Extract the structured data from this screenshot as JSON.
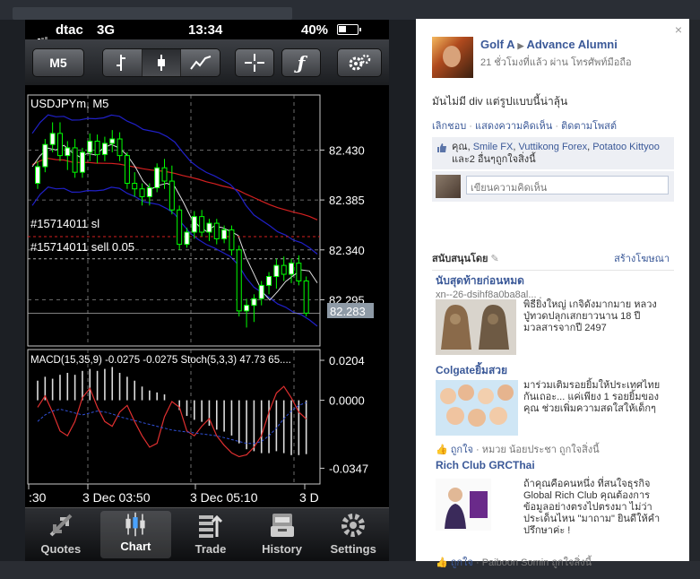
{
  "status_bar": {
    "carrier": "dtac",
    "network": "3G",
    "time": "13:34",
    "battery": "40%"
  },
  "toolbar": {
    "timeframe_label": "M5",
    "icons": [
      "bar-chart-icon",
      "candlestick-icon",
      "line-chart-icon",
      "crosshair-icon",
      "function-icon",
      "settings-gears-icon"
    ]
  },
  "chart_data": [
    {
      "type": "candlestick",
      "title": "USDJPYm, M5",
      "ylim": [
        82.255,
        82.478
      ],
      "y_ticks": [
        "82.430",
        "82.385",
        "82.340",
        "82.295"
      ],
      "current_price": "82.283",
      "annotations": [
        "#15714011 sl",
        "#15714011 sell 0.05"
      ],
      "candles": [
        {
          "o": 82.4,
          "h": 82.42,
          "l": 82.395,
          "c": 82.415
        },
        {
          "o": 82.415,
          "h": 82.44,
          "l": 82.41,
          "c": 82.435
        },
        {
          "o": 82.435,
          "h": 82.455,
          "l": 82.428,
          "c": 82.445
        },
        {
          "o": 82.445,
          "h": 82.455,
          "l": 82.42,
          "c": 82.425
        },
        {
          "o": 82.425,
          "h": 82.438,
          "l": 82.412,
          "c": 82.432
        },
        {
          "o": 82.432,
          "h": 82.44,
          "l": 82.405,
          "c": 82.41
        },
        {
          "o": 82.41,
          "h": 82.432,
          "l": 82.405,
          "c": 82.428
        },
        {
          "o": 82.428,
          "h": 82.445,
          "l": 82.42,
          "c": 82.438
        },
        {
          "o": 82.438,
          "h": 82.444,
          "l": 82.418,
          "c": 82.426
        },
        {
          "o": 82.426,
          "h": 82.442,
          "l": 82.42,
          "c": 82.436
        },
        {
          "o": 82.436,
          "h": 82.448,
          "l": 82.428,
          "c": 82.44
        },
        {
          "o": 82.44,
          "h": 82.446,
          "l": 82.42,
          "c": 82.425
        },
        {
          "o": 82.425,
          "h": 82.428,
          "l": 82.395,
          "c": 82.4
        },
        {
          "o": 82.4,
          "h": 82.41,
          "l": 82.388,
          "c": 82.395
        },
        {
          "o": 82.395,
          "h": 82.4,
          "l": 82.38,
          "c": 82.388
        },
        {
          "o": 82.388,
          "h": 82.4,
          "l": 82.38,
          "c": 82.396
        },
        {
          "o": 82.396,
          "h": 82.418,
          "l": 82.392,
          "c": 82.414
        },
        {
          "o": 82.414,
          "h": 82.422,
          "l": 82.395,
          "c": 82.402
        },
        {
          "o": 82.402,
          "h": 82.416,
          "l": 82.372,
          "c": 82.376
        },
        {
          "o": 82.376,
          "h": 82.38,
          "l": 82.34,
          "c": 82.345
        },
        {
          "o": 82.345,
          "h": 82.36,
          "l": 82.342,
          "c": 82.356
        },
        {
          "o": 82.356,
          "h": 82.375,
          "l": 82.35,
          "c": 82.37
        },
        {
          "o": 82.37,
          "h": 82.376,
          "l": 82.352,
          "c": 82.356
        },
        {
          "o": 82.356,
          "h": 82.368,
          "l": 82.348,
          "c": 82.364
        },
        {
          "o": 82.364,
          "h": 82.368,
          "l": 82.345,
          "c": 82.35
        },
        {
          "o": 82.35,
          "h": 82.362,
          "l": 82.346,
          "c": 82.358
        },
        {
          "o": 82.358,
          "h": 82.362,
          "l": 82.335,
          "c": 82.34
        },
        {
          "o": 82.34,
          "h": 82.344,
          "l": 82.28,
          "c": 82.285
        },
        {
          "o": 82.285,
          "h": 82.296,
          "l": 82.27,
          "c": 82.29
        },
        {
          "o": 82.29,
          "h": 82.3,
          "l": 82.275,
          "c": 82.296
        },
        {
          "o": 82.296,
          "h": 82.312,
          "l": 82.29,
          "c": 82.308
        },
        {
          "o": 82.308,
          "h": 82.32,
          "l": 82.3,
          "c": 82.316
        },
        {
          "o": 82.316,
          "h": 82.332,
          "l": 82.305,
          "c": 82.326
        },
        {
          "o": 82.326,
          "h": 82.334,
          "l": 82.312,
          "c": 82.318
        },
        {
          "o": 82.318,
          "h": 82.332,
          "l": 82.31,
          "c": 82.328
        },
        {
          "o": 82.328,
          "h": 82.335,
          "l": 82.308,
          "c": 82.312
        },
        {
          "o": 82.312,
          "h": 82.316,
          "l": 82.28,
          "c": 82.283
        }
      ],
      "sl_price": 82.352,
      "entry_price": 82.332
    },
    {
      "type": "line",
      "title": "MACD(15,35,9) -0.0275 -0.0275 Stoch(5,3,3) 47.73 65....",
      "y_ticks": [
        "0.0204",
        "0.0000",
        "-0.0347"
      ],
      "ylim": [
        -0.04,
        0.0204
      ],
      "x_ticks": [
        ":30",
        "3 Dec 03:50",
        "3 Dec 05:10",
        "3 D"
      ],
      "macd_hist": [
        0.01,
        0.012,
        0.011,
        0.013,
        0.014,
        0.013,
        0.015,
        0.016,
        0.015,
        0.016,
        0.017,
        0.014,
        0.012,
        0.01,
        0.007,
        0.005,
        0.004,
        0.003,
        0.0,
        -0.005,
        -0.008,
        -0.01,
        -0.011,
        -0.013,
        -0.015,
        -0.016,
        -0.018,
        -0.022,
        -0.025,
        -0.026,
        -0.027,
        -0.027,
        -0.026,
        -0.027,
        -0.028,
        -0.028,
        -0.0275
      ],
      "stoch": [
        60,
        72,
        55,
        35,
        30,
        45,
        70,
        80,
        60,
        45,
        40,
        55,
        62,
        45,
        30,
        18,
        22,
        50,
        66,
        60,
        35,
        30,
        40,
        48,
        30,
        20,
        12,
        8,
        10,
        18,
        30,
        55,
        75,
        82,
        70,
        55,
        47.73
      ],
      "stoch_signal": [
        45,
        52,
        56,
        58,
        56,
        54,
        52,
        54,
        56,
        55,
        53,
        50,
        48,
        46,
        44,
        42,
        40,
        38,
        36,
        35,
        34,
        33,
        32,
        31,
        30,
        28,
        26,
        24,
        22,
        22,
        24,
        30,
        38,
        48,
        56,
        62,
        65
      ]
    }
  ],
  "tabbar": {
    "items": [
      {
        "label": "Quotes",
        "icon": "quotes-arrows-icon"
      },
      {
        "label": "Chart",
        "icon": "candlestick-chart-icon"
      },
      {
        "label": "Trade",
        "icon": "trade-list-icon"
      },
      {
        "label": "History",
        "icon": "history-archive-icon"
      },
      {
        "label": "Settings",
        "icon": "settings-gear-icon"
      }
    ]
  },
  "facebook": {
    "author": "Golf A",
    "target": "Advance Alumni",
    "meta": "21 ชั่วโมงที่แล้ว ผ่าน โทรศัพท์มือถือ",
    "post_text": "มันไม่มี div แต่รูปแบบนี้น่าลุ้น",
    "actions": [
      "เลิกชอบ",
      "แสดงความคิดเห็น",
      "ติดตามโพสต์"
    ],
    "likes": {
      "prefix": "คุณ,",
      "names": [
        "Smile FX",
        "Vuttikong Forex",
        "Potatoo Kittyoo"
      ],
      "sep": ",",
      "suffix": "และ2 อื่นๆถูกใจสิ่งนี้"
    },
    "comment_placeholder": "เขียนความคิดเห็น",
    "sponsored_label": "สนับสนุนโดย",
    "create_ad_label": "สร้างโฆษณา",
    "ads": [
      {
        "title": "นับสุดท้ายก่อนหมด",
        "url": "xn--26-dsihf8a0ba8al...",
        "text": "พิธียิ่งใหญ่ เกจิดังมากมาย หลวงปู่ทวดปลุกเสกยาวนาน 18 ปีมวลสารจากปี 2497",
        "like": ""
      },
      {
        "title": "Colgateยิ้มสวย",
        "url": "",
        "text": "มาร่วมเติมรอยยิ้มให้ประเทศไทยกันเถอะ... แค่เพียง 1 รอยยิ้มของคุณ ช่วยเพิ่มความสดใสให้เด็กๆ",
        "like_label": "ถูกใจ",
        "like_rest": "· หมวย น้อยประชา ถูกใจสิ่งนี้"
      },
      {
        "title": "Rich Club GRCThai",
        "url": "",
        "text": "ถ้าคุณคือคนหนึ่ง ที่สนใจธุรกิจ Global Rich Club คุณต้องการข้อมูลอย่างตรงไปตรงมา ไม่ว่าประเด็นไหน \"มาถาม\" ยินดีให้คำปรึกษาค่ะ !",
        "like_label": "ถูกใจ",
        "like_rest": "· Paiboon Somin ถูกใจสิ่งนี้"
      }
    ]
  },
  "colors": {
    "bull_candle": "#ffffff",
    "bear_candle": "#00ff00",
    "ma_red": "#d42020",
    "ma_blue": "#2020c8",
    "ma_white": "#e0e0e0",
    "fb_link": "#3b5998"
  }
}
